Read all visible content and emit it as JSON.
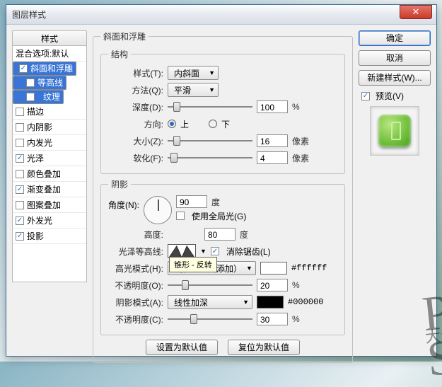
{
  "window": {
    "title": "图层样式"
  },
  "left": {
    "header": "样式",
    "items": [
      {
        "label": "混合选项:默认",
        "checked": null
      },
      {
        "label": "斜面和浮雕",
        "checked": true,
        "selected": true
      },
      {
        "label": "等高线",
        "checked": false,
        "indent": true,
        "selected": true
      },
      {
        "label": "纹理",
        "checked": false,
        "indent": true,
        "selected": true
      },
      {
        "label": "描边",
        "checked": false
      },
      {
        "label": "内阴影",
        "checked": false
      },
      {
        "label": "内发光",
        "checked": false
      },
      {
        "label": "光泽",
        "checked": true
      },
      {
        "label": "颜色叠加",
        "checked": false
      },
      {
        "label": "渐变叠加",
        "checked": true
      },
      {
        "label": "图案叠加",
        "checked": false
      },
      {
        "label": "外发光",
        "checked": true
      },
      {
        "label": "投影",
        "checked": true
      }
    ]
  },
  "mid": {
    "group_title": "斜面和浮雕",
    "struct": {
      "legend": "结构",
      "style_lbl": "样式(T):",
      "style_val": "内斜面",
      "method_lbl": "方法(Q):",
      "method_val": "平滑",
      "depth_lbl": "深度(D):",
      "depth_val": "100",
      "depth_unit": "%",
      "dir_lbl": "方向:",
      "dir_up": "上",
      "dir_down": "下",
      "size_lbl": "大小(Z):",
      "size_val": "16",
      "size_unit": "像素",
      "soften_lbl": "软化(F):",
      "soften_val": "4",
      "soften_unit": "像素"
    },
    "shade": {
      "legend": "阴影",
      "angle_lbl": "角度(N):",
      "angle_val": "90",
      "angle_unit": "度",
      "global_lbl": "使用全局光(G)",
      "alt_lbl": "高度:",
      "alt_val": "80",
      "alt_unit": "度",
      "contour_lbl": "光泽等高线:",
      "contour_tip": "锥形 - 反转",
      "antialias_lbl": "消除锯齿(L)",
      "hi_mode_lbl": "高光模式(H):",
      "hi_mode_val": "线性减淡（添加）",
      "hi_color": "#ffffff",
      "hi_hex": "#ffffff",
      "hi_op_lbl": "不透明度(O):",
      "hi_op_val": "20",
      "hi_op_unit": "%",
      "sh_mode_lbl": "阴影模式(A):",
      "sh_mode_val": "线性加深",
      "sh_color": "#000000",
      "sh_hex": "#000000",
      "sh_op_lbl": "不透明度(C):",
      "sh_op_val": "30",
      "sh_op_unit": "%"
    },
    "btn_default": "设置为默认值",
    "btn_reset": "复位为默认值"
  },
  "right": {
    "ok": "确定",
    "cancel": "取消",
    "newstyle": "新建样式(W)...",
    "preview": "预览(V)"
  }
}
